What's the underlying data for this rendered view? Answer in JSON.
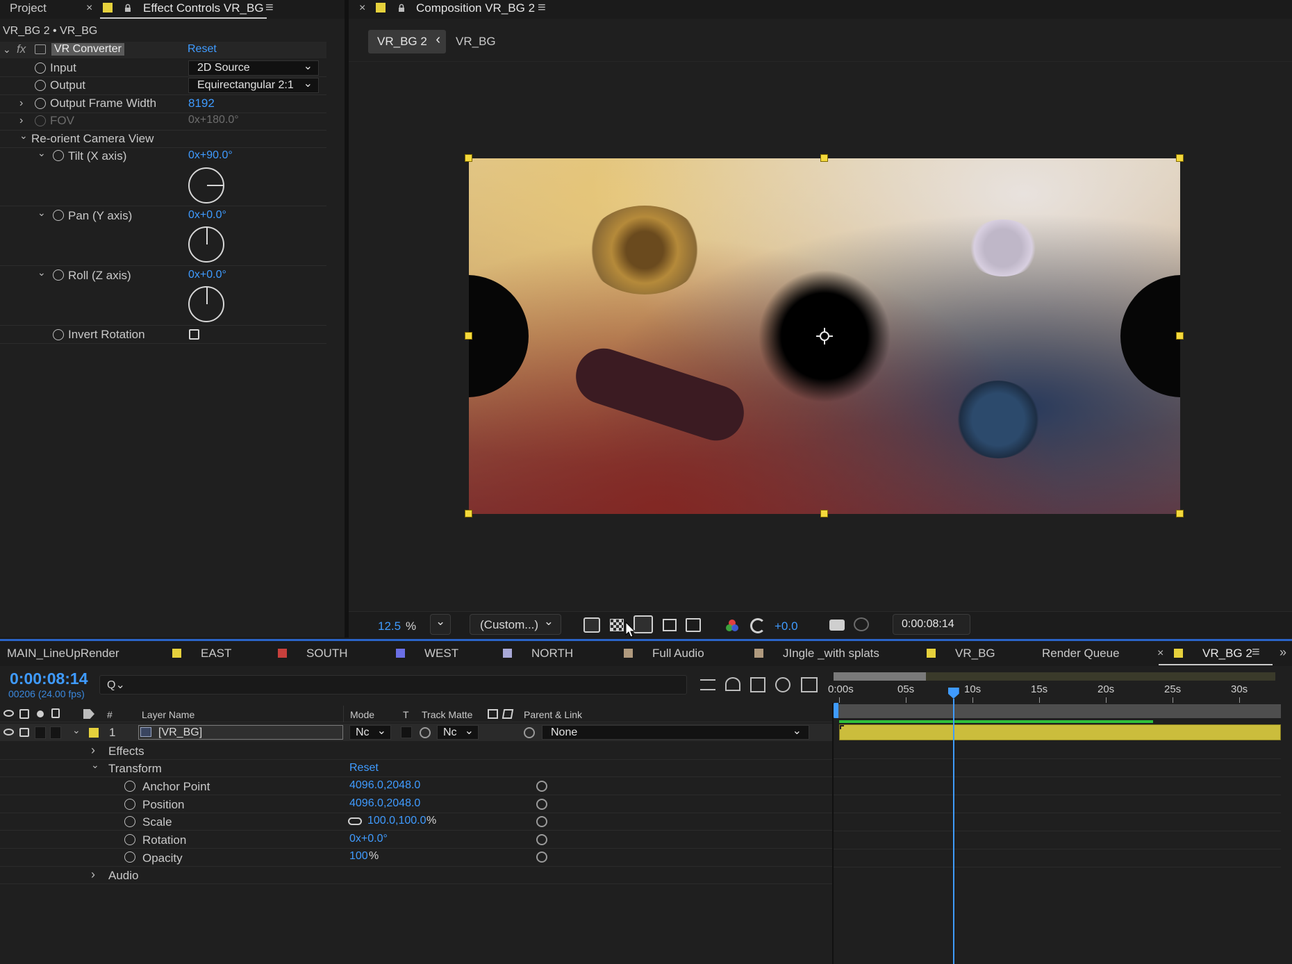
{
  "tabs_left": {
    "project": "Project",
    "close": "×",
    "effect_controls": "Effect Controls VR_BG",
    "menu": "≡"
  },
  "tabs_comp": {
    "close": "×",
    "title": "Composition VR_BG 2",
    "menu": "≡"
  },
  "effect_controls": {
    "breadcrumb": "VR_BG 2 • VR_BG",
    "fx": "fx",
    "effect_name": "VR Converter",
    "reset": "Reset",
    "input_label": "Input",
    "input_value": "2D Source",
    "output_label": "Output",
    "output_value": "Equirectangular 2:1",
    "frame_width_label": "Output Frame Width",
    "frame_width_value": "8192",
    "fov_label": "FOV",
    "fov_value": "0x+180.0°",
    "reorient_label": "Re-orient Camera View",
    "tilt_label": "Tilt (X axis)",
    "tilt_value": "0x+90.0°",
    "pan_label": "Pan (Y axis)",
    "pan_value": "0x+0.0°",
    "roll_label": "Roll (Z axis)",
    "roll_value": "0x+0.0°",
    "invert_label": "Invert Rotation",
    "invert_checked": false
  },
  "viewer": {
    "tab_active": "VR_BG 2",
    "tab_arrow": "‹",
    "tab_other": "VR_BG"
  },
  "viewer_toolbar": {
    "zoom": "12.5",
    "zoom_unit": "%",
    "resolution": "(Custom...)",
    "exposure": "+0.0",
    "timecode": "0:00:08:14"
  },
  "timeline_tabs": [
    {
      "label": "MAIN_LineUpRender",
      "color": ""
    },
    {
      "label": "EAST",
      "color": "#e6d13c"
    },
    {
      "label": "SOUTH",
      "color": "#c8403c"
    },
    {
      "label": "WEST",
      "color": "#6b6fe6"
    },
    {
      "label": "NORTH",
      "color": "#a9a9d8"
    },
    {
      "label": "Full Audio",
      "color": "#b09a7e"
    },
    {
      "label": "JIngle _with splats",
      "color": "#b09a7e"
    },
    {
      "label": "VR_BG",
      "color": "#e6d13c"
    },
    {
      "label": "Render Queue",
      "color": ""
    },
    {
      "label": "VR_BG 2",
      "color": "#e6d13c"
    }
  ],
  "timeline_tab_close": "×",
  "timeline_tab_menu": "≡",
  "timeline_tab_more": "»",
  "timeline": {
    "timecode": "0:00:08:14",
    "frames": "00206 (24.00 fps)",
    "search_icon": "Q⌄"
  },
  "columns": {
    "hash": "#",
    "layer_name": "Layer Name",
    "mode": "Mode",
    "t": "T",
    "track_matte": "Track Matte",
    "parent": "Parent & Link"
  },
  "layer": {
    "number": "1",
    "name": "[VR_BG]",
    "mode": "Nc",
    "matte": "Nc",
    "parent": "None",
    "color": "#e6d13c"
  },
  "properties": {
    "effects": "Effects",
    "transform": "Transform",
    "reset": "Reset",
    "anchor_label": "Anchor Point",
    "anchor_value": "4096.0,2048.0",
    "position_label": "Position",
    "position_value": "4096.0,2048.0",
    "scale_label": "Scale",
    "scale_value": "100.0,100.0",
    "scale_unit": "%",
    "rotation_label": "Rotation",
    "rotation_value": "0x+0.0°",
    "opacity_label": "Opacity",
    "opacity_value": "100",
    "opacity_unit": "%",
    "audio": "Audio"
  },
  "ruler": {
    "ticks": [
      "0:00s",
      "05s",
      "10s",
      "15s",
      "20s",
      "25s",
      "30s"
    ]
  },
  "playhead_seconds": 8.58
}
